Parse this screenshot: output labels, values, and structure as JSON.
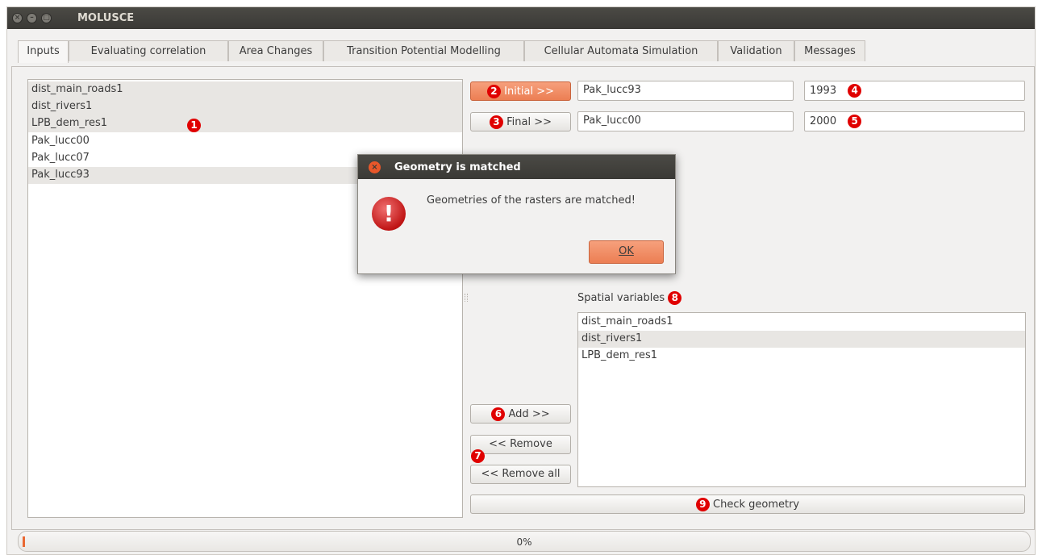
{
  "window": {
    "title": "MOLUSCE"
  },
  "tabs": [
    {
      "label": "Inputs"
    },
    {
      "label": "Evaluating correlation"
    },
    {
      "label": "Area Changes"
    },
    {
      "label": "Transition Potential Modelling"
    },
    {
      "label": "Cellular Automata Simulation"
    },
    {
      "label": "Validation"
    },
    {
      "label": "Messages"
    }
  ],
  "layers": {
    "items": [
      {
        "label": "dist_main_roads1"
      },
      {
        "label": "dist_rivers1"
      },
      {
        "label": "LPB_dem_res1"
      },
      {
        "label": "Pak_lucc00"
      },
      {
        "label": "Pak_lucc07"
      },
      {
        "label": "Pak_lucc93"
      }
    ],
    "badge": "1"
  },
  "initial": {
    "badge": "2",
    "button": "Initial >>",
    "layer": "Pak_lucc93",
    "year": "1993",
    "year_badge": "4"
  },
  "final": {
    "badge": "3",
    "button": "Final >>",
    "layer": "Pak_lucc00",
    "year": "2000",
    "year_badge": "5"
  },
  "spatial": {
    "label": "Spatial variables",
    "badge": "8",
    "items": [
      {
        "label": "dist_main_roads1"
      },
      {
        "label": "dist_rivers1"
      },
      {
        "label": "LPB_dem_res1"
      }
    ]
  },
  "actions": {
    "add_badge": "6",
    "add": "Add >>",
    "remove": "<< Remove",
    "remove_badge": "7",
    "remove_all": "<< Remove all",
    "check_badge": "9",
    "check": "Check geometry"
  },
  "progress": {
    "value": 0,
    "text": "0%"
  },
  "dialog": {
    "title": "Geometry is matched",
    "message": "Geometries of the rasters are matched!",
    "ok": "OK"
  },
  "colors": {
    "accent": "#ec7e53",
    "badge": "#e00000",
    "titlebar": "#3c3b37"
  }
}
